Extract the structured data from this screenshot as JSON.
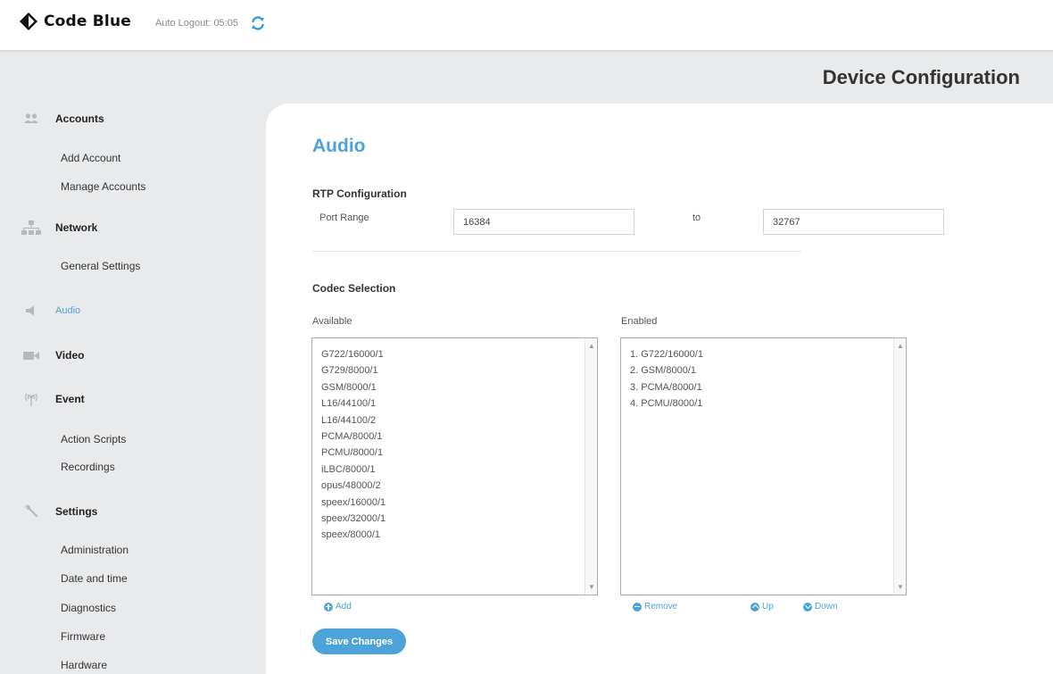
{
  "header": {
    "brand": "Code Blue",
    "auto_logout": "Auto Logout: 05:05"
  },
  "page_title": "Device Configuration",
  "sidebar": {
    "sections": [
      {
        "label": "Accounts",
        "icon": "users-icon",
        "subitems": [
          "Add Account",
          "Manage Accounts"
        ]
      },
      {
        "label": "Network",
        "icon": "network-icon",
        "subitems": [
          "General Settings"
        ]
      },
      {
        "label": "Audio",
        "icon": "speaker-icon",
        "active": true,
        "subitems": []
      },
      {
        "label": "Video",
        "icon": "video-camera-icon",
        "subitems": []
      },
      {
        "label": "Event",
        "icon": "broadcast-icon",
        "subitems": [
          "Action Scripts",
          "Recordings"
        ]
      },
      {
        "label": "Settings",
        "icon": "wrench-icon",
        "subitems": [
          "Administration",
          "Date and time",
          "Diagnostics",
          "Firmware",
          "Hardware"
        ]
      }
    ]
  },
  "main": {
    "heading": "Audio",
    "rtp": {
      "title": "RTP Configuration",
      "port_range_label": "Port Range",
      "port_start": "16384",
      "to_label": "to",
      "port_end": "32767"
    },
    "codec": {
      "title": "Codec Selection",
      "available_label": "Available",
      "enabled_label": "Enabled",
      "available": [
        "G722/16000/1",
        "G729/8000/1",
        "GSM/8000/1",
        "L16/44100/1",
        "L16/44100/2",
        "PCMA/8000/1",
        "PCMU/8000/1",
        "iLBC/8000/1",
        "opus/48000/2",
        "speex/16000/1",
        "speex/32000/1",
        "speex/8000/1"
      ],
      "enabled": [
        "1. G722/16000/1",
        "2. GSM/8000/1",
        "3. PCMA/8000/1",
        "4. PCMU/8000/1"
      ],
      "add_label": "Add",
      "remove_label": "Remove",
      "up_label": "Up",
      "down_label": "Down"
    },
    "save_label": "Save Changes"
  },
  "colors": {
    "accent": "#4ba3d9",
    "background": "#e9eaec"
  }
}
